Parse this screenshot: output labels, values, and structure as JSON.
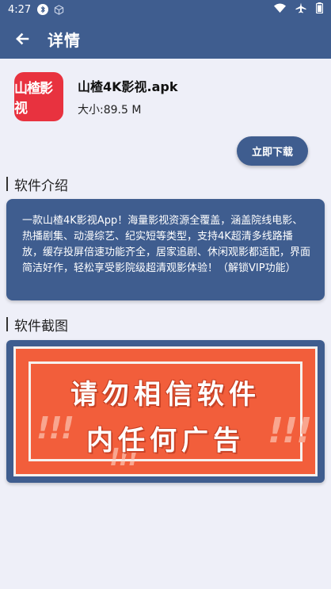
{
  "status_bar": {
    "time": "4:27",
    "icons": [
      "bluetooth-icon",
      "cube-icon",
      "wifi-icon",
      "airplane-icon",
      "battery-icon"
    ]
  },
  "app_bar": {
    "back_icon": "arrow-left-icon",
    "title": "详情"
  },
  "app": {
    "logo_text": "山楂影视",
    "name": "山楂4K影视.apk",
    "size": "大小:89.5 M",
    "download_label": "立即下载"
  },
  "intro": {
    "heading": "软件介绍",
    "text": "一款山楂4K影视App！海量影视资源全覆盖，涵盖院线电影、热播剧集、动漫综艺、纪实短等类型，支持4K超清多线路播放，缓存投屏倍速功能齐全，居家追剧、休闲观影都适配，界面简洁好作，轻松享受影院级超清观影体验！（解锁VIP功能）"
  },
  "screenshots": {
    "heading": "软件截图",
    "ad_line1": "请勿相信软件",
    "ad_line2": "内任何广告"
  },
  "colors": {
    "primary": "#3f5d8f",
    "background": "#eeeff8",
    "logo_red": "#e8323f",
    "banner_orange": "#f25e3b"
  }
}
